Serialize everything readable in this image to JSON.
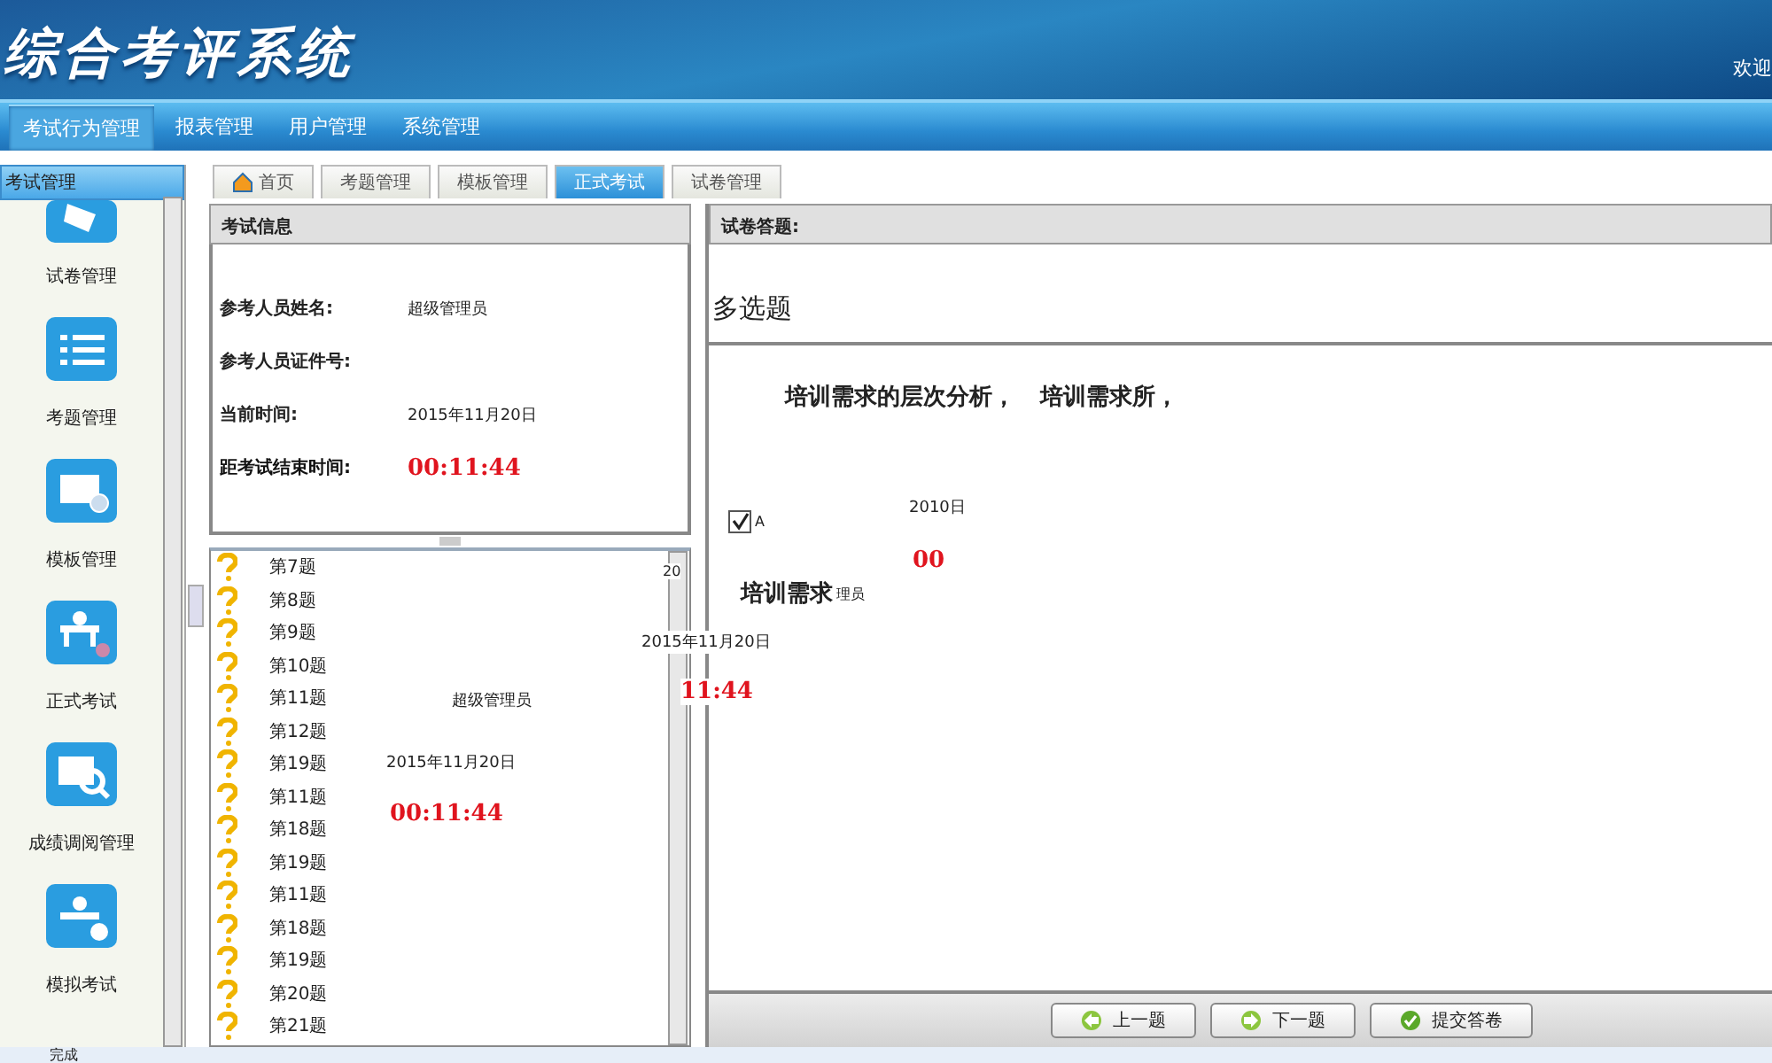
{
  "header": {
    "title": "综合考评系统",
    "welcome": "欢迎"
  },
  "nav": [
    {
      "label": "考试行为管理",
      "selected": true
    },
    {
      "label": "报表管理",
      "selected": false
    },
    {
      "label": "用户管理",
      "selected": false
    },
    {
      "label": "系统管理",
      "selected": false
    }
  ],
  "sidebar": {
    "title": "考试管理",
    "items": [
      {
        "label": "试卷管理",
        "kind": "paper"
      },
      {
        "label": "考题管理",
        "kind": "list"
      },
      {
        "label": "模板管理",
        "kind": "template"
      },
      {
        "label": "正式考试",
        "kind": "exam"
      },
      {
        "label": "成绩调阅管理",
        "kind": "score"
      },
      {
        "label": "模拟考试",
        "kind": "mock"
      }
    ]
  },
  "tabs": [
    {
      "label": "首页",
      "kind": "home",
      "selected": false
    },
    {
      "label": "考题管理",
      "kind": "plain",
      "selected": false
    },
    {
      "label": "模板管理",
      "kind": "plain",
      "selected": false
    },
    {
      "label": "正式考试",
      "kind": "plain",
      "selected": true
    },
    {
      "label": "试卷管理",
      "kind": "plain",
      "selected": false
    }
  ],
  "exam_info": {
    "title": "考试信息",
    "fields": [
      {
        "label": "参考人员姓名:",
        "value": "超级管理员",
        "kind": "text"
      },
      {
        "label": "参考人员证件号:",
        "kind": "text"
      },
      {
        "label": "当前时间:",
        "value": "2015年11月20日",
        "kind": "text"
      },
      {
        "label": "距考试结束时间:",
        "value": "00:11:44",
        "kind": "timer"
      }
    ]
  },
  "questions": [
    "第7题",
    "第8题",
    "第9题",
    "第10题",
    "第11题",
    "第12题",
    "第19题",
    "第11题",
    "第18题",
    "第19题",
    "第11题",
    "第18题",
    "第19题",
    "第20题",
    "第21题"
  ],
  "answer": {
    "title": "试卷答题:",
    "type": "多选题",
    "question": "培训需求的层次分析，",
    "question_tail": "培训需求所，",
    "option": {
      "label": "A",
      "checked": true
    }
  },
  "buttons": [
    {
      "label": "上一题",
      "kind": "prev"
    },
    {
      "label": "下一题",
      "kind": "next"
    },
    {
      "label": "提交答卷",
      "kind": "submit"
    }
  ],
  "status_bar": "完成",
  "fragments": [
    {
      "text": "20",
      "kind": "plain"
    },
    {
      "text": "2015年11月20日",
      "kind": "plain"
    },
    {
      "text": "11:44",
      "kind": "timer"
    },
    {
      "text": "超级管理员",
      "kind": "plain"
    },
    {
      "text": "2015年11月20日",
      "kind": "plain"
    },
    {
      "text": "00:11:44",
      "kind": "timer"
    },
    {
      "text": "培训需求",
      "kind": "big"
    },
    {
      "text": "理员",
      "kind": "plain"
    },
    {
      "text": "2010日",
      "kind": "plain"
    },
    {
      "text": "00",
      "kind": "timer"
    }
  ]
}
